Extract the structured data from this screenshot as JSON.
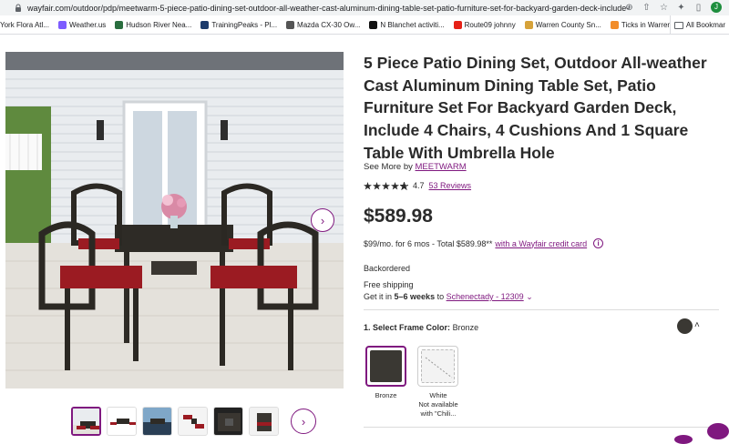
{
  "browser": {
    "url": "wayfair.com/outdoor/pdp/meetwarm-5-piece-patio-dining-set-outdoor-all-weather-cast-aluminum-dining-table-set-patio-furniture-set-for-backyard-garden-deck-include-4-ch...",
    "bookmarks": [
      {
        "label": "York Flora Atl...",
        "color": "#ffffff"
      },
      {
        "label": "Weather.us",
        "color": "#7d5cff"
      },
      {
        "label": "Hudson River Nea...",
        "color": "#2a6e3f"
      },
      {
        "label": "TrainingPeaks - Pl...",
        "color": "#1b3a6b"
      },
      {
        "label": "Mazda CX-30 Ow...",
        "color": "#555555"
      },
      {
        "label": "N Blanchet activiti...",
        "color": "#111111"
      },
      {
        "label": "Route09 johnny",
        "color": "#e62117"
      },
      {
        "label": "Warren County Sn...",
        "color": "#d6a23a"
      },
      {
        "label": "Ticks in Warren C...",
        "color": "#f28c28"
      }
    ],
    "all_bookmarks": "All Bookmar"
  },
  "product": {
    "title": "5 Piece Patio Dining Set, Outdoor All-weather Cast Aluminum Dining Table Set, Patio Furniture Set For Backyard Garden Deck, Include 4 Chairs, 4 Cushions And 1 Square Table With Umbrella Hole",
    "see_more_prefix": "See More by",
    "brand": "MEETWARM",
    "rating": "4.7",
    "reviews": "53 Reviews",
    "price": "$589.98",
    "financing_text": "$99/mo. for 6 mos - Total $589.98**",
    "financing_link": "with a Wayfair credit card",
    "stock": "Backordered",
    "shipping": "Free shipping",
    "delivery_prefix": "Get it in",
    "delivery_time": "5–6 weeks",
    "delivery_to": "to",
    "location": "Schenectady - 12309",
    "color_label": "1. Select Frame Color:",
    "color_value": "Bronze",
    "options": [
      {
        "label": "Bronze"
      },
      {
        "label": "White",
        "note1": "Not available",
        "note2": "with \"Chili..."
      }
    ]
  },
  "colors": {
    "accent": "#7f187f",
    "bronze": "#3a3833",
    "cushion": "#9b1b22"
  }
}
